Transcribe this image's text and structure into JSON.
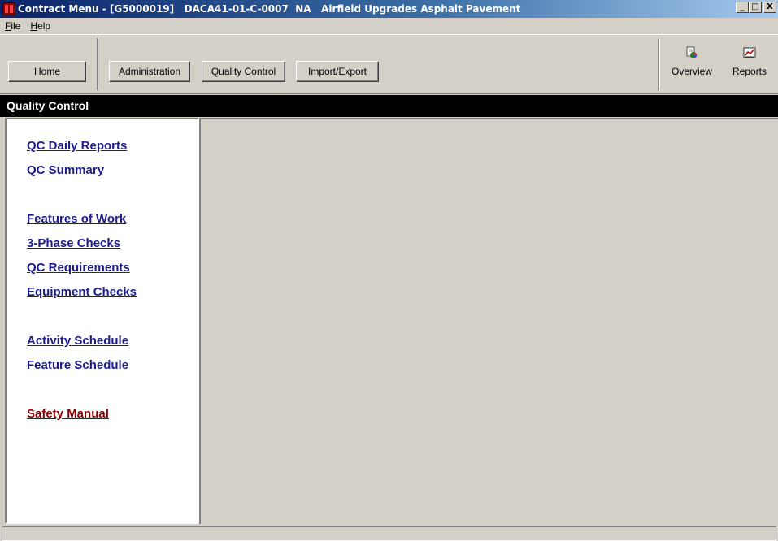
{
  "window": {
    "title": "Contract Menu - [G5000019]   DACA41-01-C-0007  NA   Airfield Upgrades Asphalt Pavement",
    "minimize_label": "_",
    "maximize_label": "□",
    "close_label": "X"
  },
  "menubar": {
    "items": [
      {
        "label": "File",
        "accel": "F",
        "rest": "ile"
      },
      {
        "label": "Help",
        "accel": "H",
        "rest": "elp"
      }
    ]
  },
  "toolbar": {
    "home_label": "Home",
    "administration_label": "Administration",
    "quality_control_label": "Quality Control",
    "import_export_label": "Import/Export",
    "overview_label": "Overview",
    "reports_label": "Reports",
    "overview_icon": "overview-icon",
    "reports_icon": "reports-icon"
  },
  "section": {
    "title": "Quality Control"
  },
  "nav": {
    "qc_daily_reports": "QC Daily Reports",
    "qc_summary": "QC Summary",
    "features_of_work": "Features of Work",
    "three_phase_checks": "3-Phase Checks",
    "qc_requirements": "QC Requirements",
    "equipment_checks": "Equipment Checks",
    "activity_schedule": "Activity Schedule",
    "feature_schedule": "Feature Schedule",
    "safety_manual": "Safety Manual"
  },
  "colors": {
    "link_blue": "#1c1c8c",
    "link_red": "#8b0000",
    "titlebar_start": "#0a246a",
    "window_bg": "#d4d0c8"
  }
}
